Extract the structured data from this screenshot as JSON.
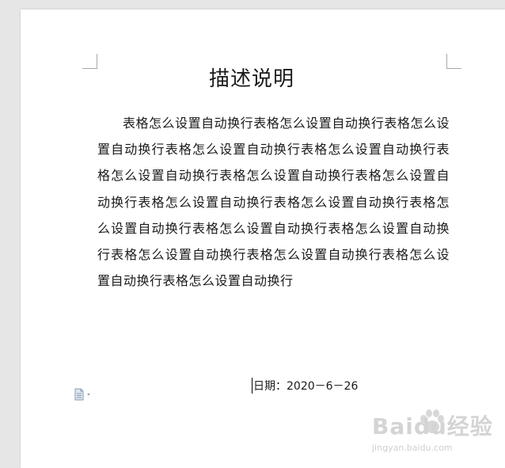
{
  "document": {
    "title": "描述说明",
    "paragraph": "表格怎么设置自动换行表格怎么设置自动换行表格怎么设置自动换行表格怎么设置自动换行表格怎么设置自动换行表格怎么设置自动换行表格怎么设置自动换行表格怎么设置自动换行表格怎么设置自动换行表格怎么设置自动换行表格怎么设置自动换行表格怎么设置自动换行表格怎么设置自动换行表格怎么设置自动换行表格怎么设置自动换行表格怎么设置自动换行表格怎么设置自动换行",
    "date_line": "日期：2020－6－26"
  },
  "paste_options": {
    "icon": "paste-options-icon"
  },
  "watermark": {
    "brand": "Baidu经验",
    "url": "jingyan.baidu.com"
  }
}
